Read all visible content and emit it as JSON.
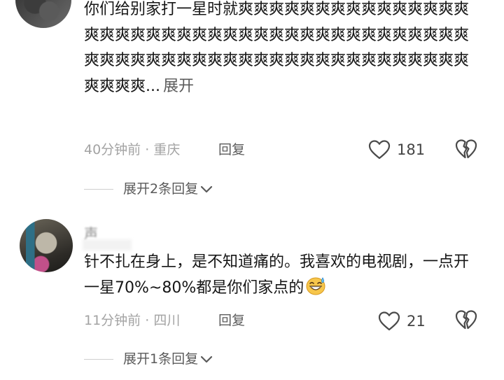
{
  "comments": [
    {
      "text": "你们给别家打一星时就爽爽爽爽爽爽爽爽爽爽爽爽爽爽爽爽爽爽爽爽爽爽爽爽爽爽爽爽爽爽爽爽爽爽爽爽爽爽爽爽爽爽爽爽爽爽爽爽爽爽爽爽爽爽爽爽爽爽爽爽爽爽爽爽爽爽爽爽爽...",
      "expand_label": "展开",
      "time": "40分钟前",
      "location": "重庆",
      "reply_label": "回复",
      "likes": "181",
      "replies_label": "展开2条回复"
    },
    {
      "author": "声",
      "text": "针不扎在身上，是不知道痛的。我喜欢的电视剧，一点开一星70%~80%都是你们家点的",
      "emoji": "sweat-grin-emoji",
      "time": "11分钟前",
      "location": "四川",
      "reply_label": "回复",
      "likes": "21",
      "replies_label": "展开1条回复"
    }
  ],
  "colors": {
    "text": "#161616",
    "muted": "#a3a3a3",
    "link": "#5b5b5b"
  }
}
